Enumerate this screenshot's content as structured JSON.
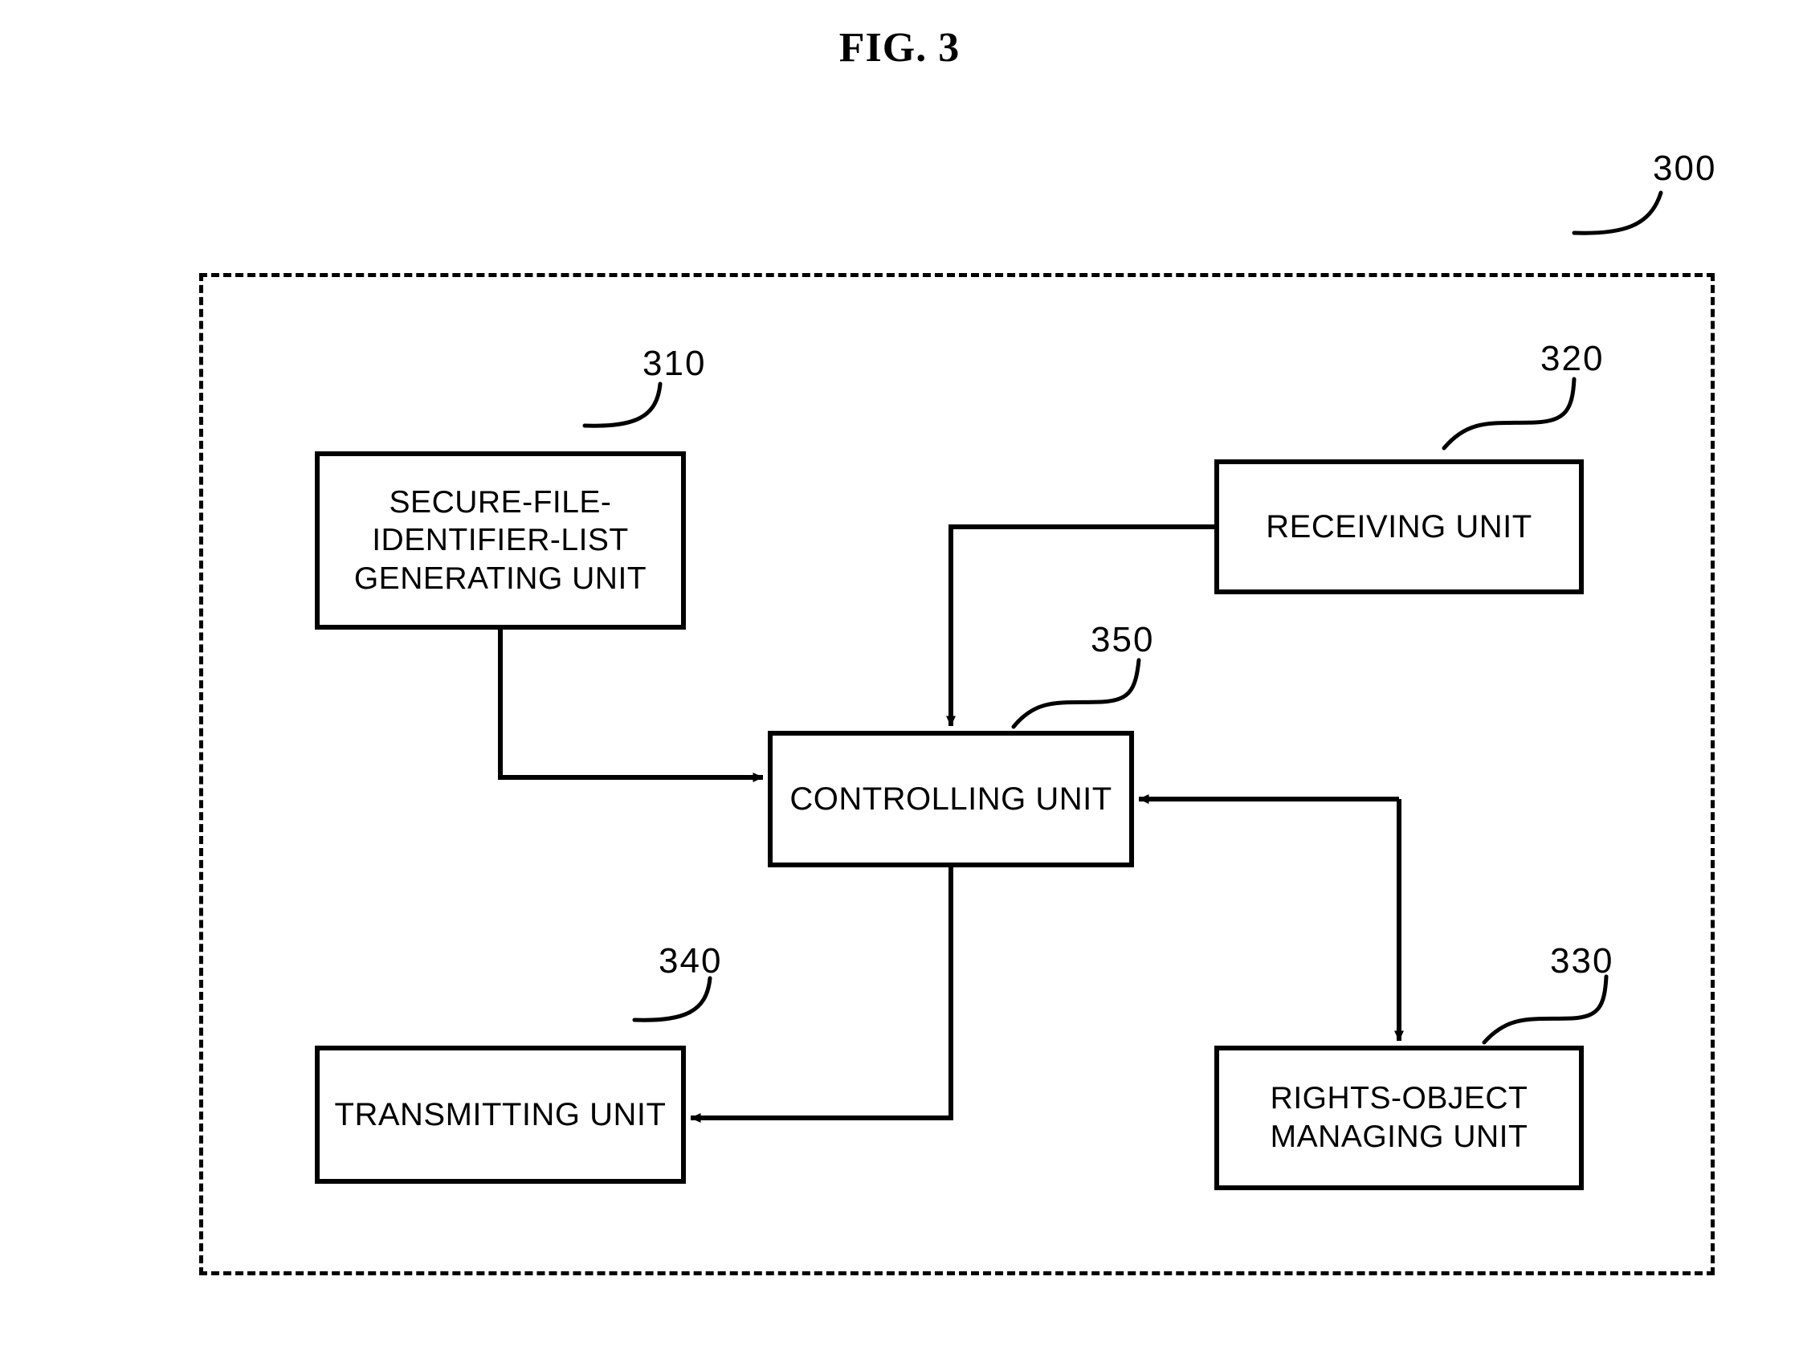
{
  "figure": {
    "title": "FIG. 3",
    "system_label": "300",
    "boundary_style": "dashed"
  },
  "blocks": [
    {
      "id": "secure-file-identifier-list-generating-unit",
      "label": "SECURE-FILE-\nIDENTIFIER-LIST\nGENERATING UNIT",
      "ref": "310"
    },
    {
      "id": "receiving-unit",
      "label": "RECEIVING UNIT",
      "ref": "320"
    },
    {
      "id": "controlling-unit",
      "label": "CONTROLLING UNIT",
      "ref": "350"
    },
    {
      "id": "transmitting-unit",
      "label": "TRANSMITTING UNIT",
      "ref": "340"
    },
    {
      "id": "rights-object-managing-unit",
      "label": "RIGHTS-OBJECT\nMANAGING UNIT",
      "ref": "330"
    }
  ],
  "connections": [
    {
      "from": "secure-file-identifier-list-generating-unit",
      "to": "controlling-unit",
      "arrow": "single"
    },
    {
      "from": "receiving-unit",
      "to": "controlling-unit",
      "arrow": "single"
    },
    {
      "from": "rights-object-managing-unit",
      "to": "controlling-unit",
      "arrow": "single"
    },
    {
      "from": "controlling-unit",
      "to": "rights-object-managing-unit",
      "arrow": "single"
    },
    {
      "from": "controlling-unit",
      "to": "transmitting-unit",
      "arrow": "single"
    }
  ],
  "colors": {
    "ink": "#000000",
    "paper": "#ffffff"
  }
}
